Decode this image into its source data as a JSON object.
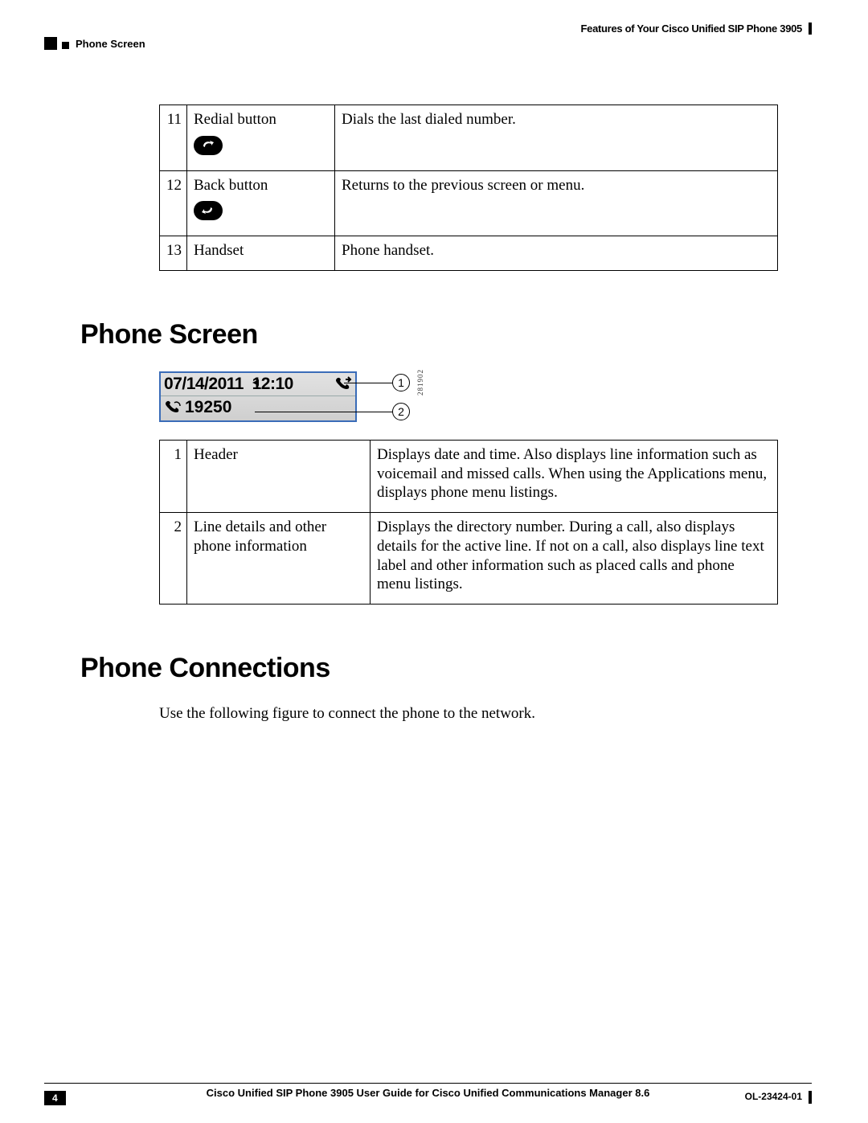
{
  "header": {
    "chapter_title": "Features of Your Cisco Unified SIP Phone 3905",
    "section_label": "Phone Screen"
  },
  "table1": {
    "rows": [
      {
        "num": "11",
        "name": "Redial button",
        "desc": "Dials the last dialed number.",
        "icon": "redial"
      },
      {
        "num": "12",
        "name": "Back button",
        "desc": "Returns to the previous screen or menu.",
        "icon": "back"
      },
      {
        "num": "13",
        "name": "Handset",
        "desc": "Phone handset."
      }
    ]
  },
  "section_phone_screen": {
    "heading": "Phone Screen",
    "screen": {
      "date": "07/14/2011",
      "time": "12:10",
      "extension": "19250",
      "figure_code": "281902"
    },
    "callouts": {
      "c1": "1",
      "c2": "2"
    },
    "table": {
      "rows": [
        {
          "num": "1",
          "name": "Header",
          "desc": "Displays date and time. Also displays line information such as voicemail and missed calls. When using the Applications menu, displays phone menu listings."
        },
        {
          "num": "2",
          "name": "Line details and other phone information",
          "desc": "Displays the directory number. During a call, also displays details for the active line. If not on a call, also displays line text label and other information such as placed calls and phone menu listings."
        }
      ]
    }
  },
  "section_connections": {
    "heading": "Phone Connections",
    "body": "Use the following figure to connect the phone to the network."
  },
  "footer": {
    "title": "Cisco Unified SIP Phone 3905 User Guide for Cisco Unified Communications Manager 8.6",
    "page": "4",
    "docid": "OL-23424-01"
  }
}
